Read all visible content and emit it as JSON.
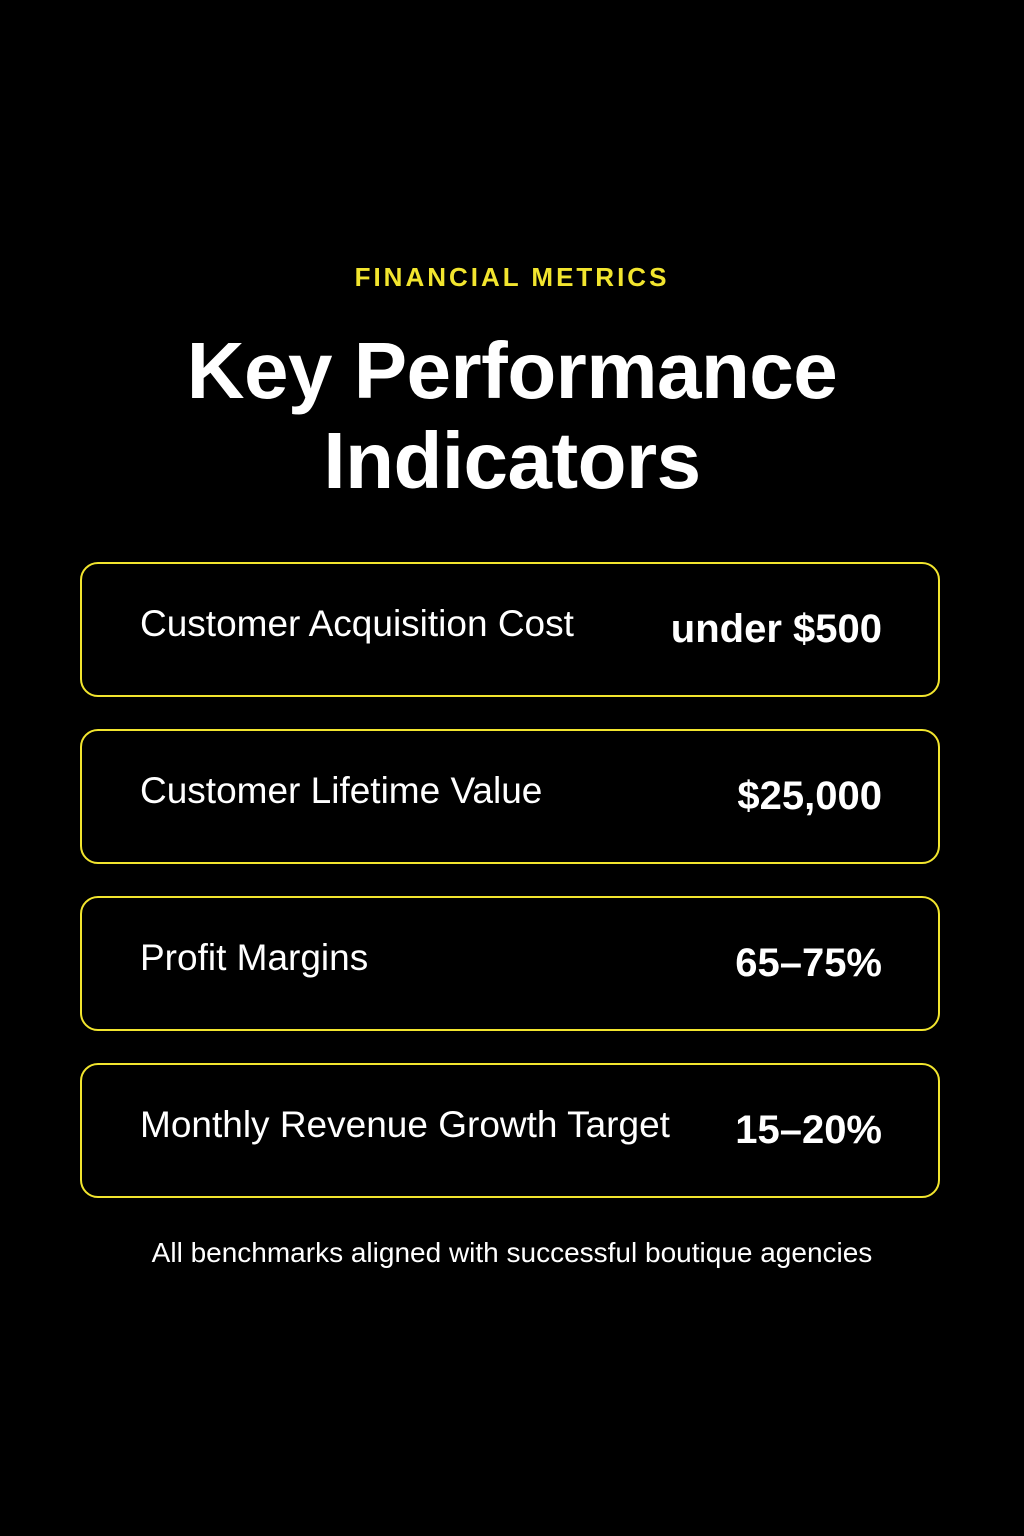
{
  "header": {
    "eyebrow": "FINANCIAL  METRICS",
    "title_line1": "Key Performance",
    "title_line2": "Indicators"
  },
  "metrics": [
    {
      "label": "Customer Acquisition Cost",
      "value": "under $500"
    },
    {
      "label": "Customer Lifetime Value",
      "value": "$25,000"
    },
    {
      "label": "Profit Margins",
      "value": "65–75%"
    },
    {
      "label": "Monthly Revenue Growth Target",
      "value": "15–20%"
    }
  ],
  "footnote": "All benchmarks aligned with successful boutique agencies",
  "colors": {
    "background": "#000000",
    "accent": "#f2e52e",
    "text": "#ffffff"
  }
}
